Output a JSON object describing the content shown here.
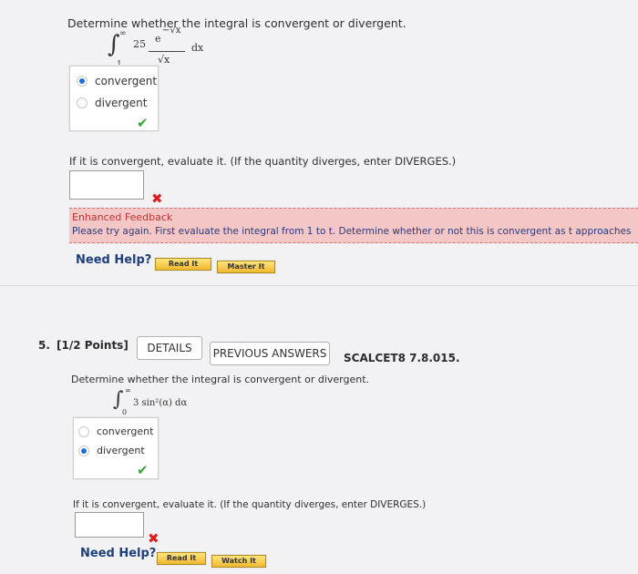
{
  "q4": {
    "prompt": "Determine whether the integral is convergent or divergent.",
    "integral": {
      "sign": "∫",
      "upper": "∞",
      "lower": "1",
      "coef": "25",
      "numer": "e",
      "numer_exp": "−√x",
      "denom": "√x",
      "dx": "dx"
    },
    "choices": [
      {
        "label": "convergent",
        "selected": true
      },
      {
        "label": "divergent",
        "selected": false
      }
    ],
    "mark": "✔",
    "evaluate_prompt": "If it is convergent, evaluate it. (If the quantity diverges, enter DIVERGES.)",
    "answer_value": "",
    "wrong_mark": "✖",
    "feedback": {
      "title": "Enhanced Feedback",
      "message": "Please try again. First evaluate the integral from 1 to t. Determine whether or not this is convergent as t approaches"
    },
    "need_help": "Need Help?",
    "help_buttons": [
      "Read It",
      "Master It"
    ]
  },
  "q5": {
    "number": "5.",
    "points": "[1/2 Points]",
    "details": "DETAILS",
    "previous_answers": "PREVIOUS ANSWERS",
    "code": "SCALCET8 7.8.015.",
    "prompt": "Determine whether the integral is convergent or divergent.",
    "integral": {
      "sign": "∫",
      "upper": "∞",
      "lower": "0",
      "expr": "3 sin²(α) dα"
    },
    "choices": [
      {
        "label": "convergent",
        "selected": false
      },
      {
        "label": "divergent",
        "selected": true
      }
    ],
    "mark": "✔",
    "evaluate_prompt": "If it is convergent, evaluate it. (If the quantity diverges, enter DIVERGES.)",
    "answer_value": "",
    "wrong_mark": "✖",
    "need_help": "Need Help?",
    "help_buttons": [
      "Read It",
      "Watch It"
    ]
  }
}
